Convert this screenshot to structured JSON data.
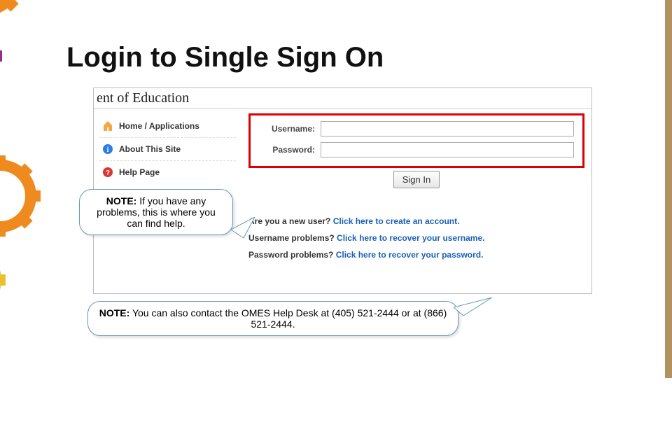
{
  "title": "Login to Single Sign On",
  "screenshot": {
    "header_fragment": "ent of Education",
    "sidebar": {
      "items": [
        {
          "label": "Home / Applications"
        },
        {
          "label": "About This Site"
        },
        {
          "label": "Help Page"
        }
      ]
    },
    "login": {
      "username_label": "Username:",
      "password_label": "Password:",
      "signin_label": "Sign In"
    },
    "help_links": {
      "new_user_q": "Are you a new user? ",
      "new_user_a": "Click here to create an account.",
      "username_q": "Username problems? ",
      "username_a": "Click here to recover your username.",
      "password_q": "Password problems? ",
      "password_a": "Click here to recover your password."
    }
  },
  "callout1": {
    "bold": "NOTE:",
    "text": "  If you have any problems, this is where you can find help."
  },
  "callout2": {
    "bold": "NOTE:",
    "text": "  You can also contact the OMES Help Desk at (405) 521-2444 or at (866) 521-2444."
  }
}
